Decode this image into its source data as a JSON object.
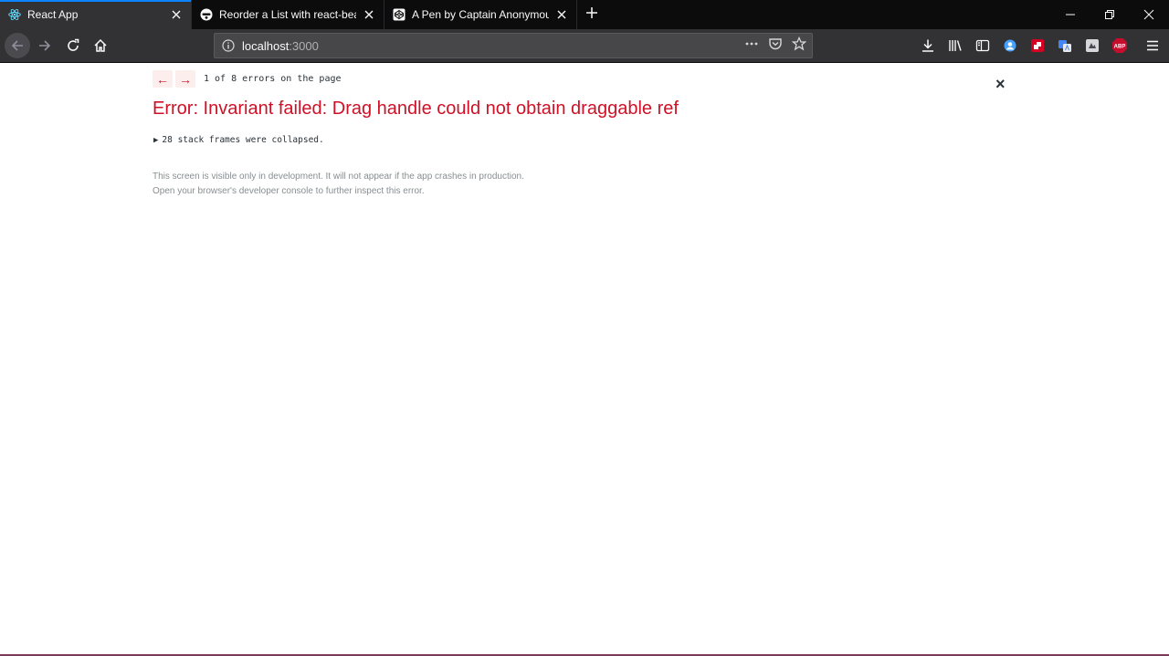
{
  "browser": {
    "tabs": [
      {
        "title": "React App",
        "icon": "react-icon",
        "active": true
      },
      {
        "title": "Reorder a List with react-beautiful-dnd",
        "icon": "egghead-icon",
        "active": false
      },
      {
        "title": "A Pen by Captain Anonymous",
        "icon": "codepen-icon",
        "active": false
      }
    ],
    "new_tab_icon": "plus-icon",
    "url_host": "localhost",
    "url_port": ":3000",
    "accent_color": "#0a84ff"
  },
  "error_overlay": {
    "prev_label": "←",
    "next_label": "→",
    "count_text": "1 of 8 errors on the page",
    "close_label": "×",
    "title": "Error: Invariant failed: Drag handle could not obtain draggable ref",
    "stack_toggle_icon": "▶",
    "stack_text": "28 stack frames were collapsed.",
    "footer_line1": "This screen is visible only in development. It will not appear if the app crashes in production.",
    "footer_line2": "Open your browser's developer console to further inspect this error.",
    "error_color": "#ce1126"
  }
}
